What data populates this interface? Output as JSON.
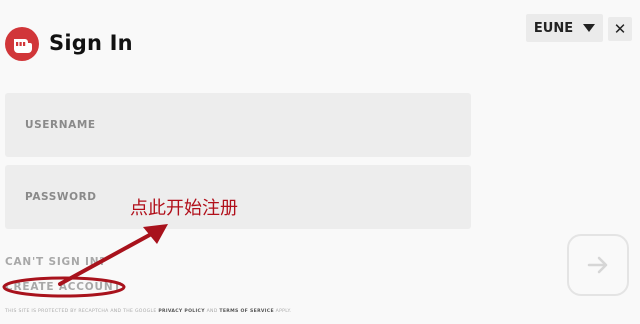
{
  "header": {
    "title": "Sign In",
    "logo_icon": "riot-fist-logo-icon",
    "brand_color": "#d13639"
  },
  "region_selector": {
    "value": "EUNE"
  },
  "close_label": "✕",
  "form": {
    "username_placeholder": "USERNAME",
    "password_placeholder": "PASSWORD"
  },
  "links": {
    "cant_sign_in": "CAN'T SIGN IN?",
    "create_account": "CREATE ACCOUNT"
  },
  "footer": {
    "prefix": "THIS SITE IS PROTECTED BY RECAPTCHA AND THE GOOGLE ",
    "privacy": "PRIVACY POLICY",
    "and": " AND ",
    "terms": "TERMS OF SERVICE",
    "suffix": " APPLY."
  },
  "annotation": {
    "text": "点此开始注册",
    "color": "#b10f1a"
  },
  "submit": {
    "icon": "arrow-right-icon"
  }
}
